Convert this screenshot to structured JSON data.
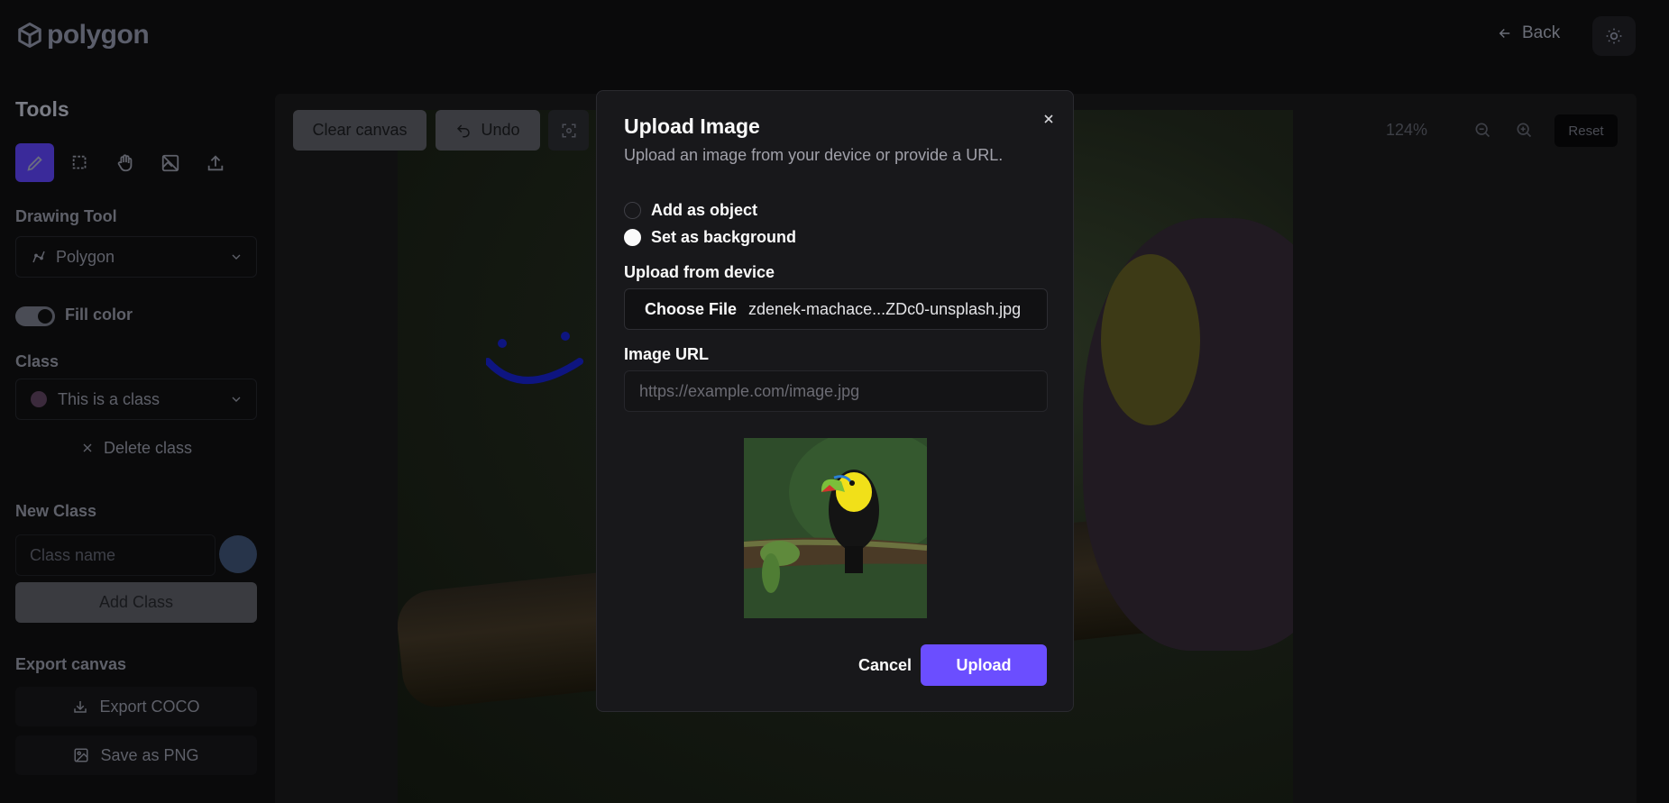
{
  "header": {
    "logo_text": "polygon",
    "back_label": "Back"
  },
  "sidebar": {
    "title": "Tools",
    "drawing_tool_label": "Drawing Tool",
    "drawing_tool_value": "Polygon",
    "fill_color_label": "Fill color",
    "class_label": "Class",
    "class_value": "This is a class",
    "delete_class_label": "Delete class",
    "new_class_label": "New Class",
    "class_name_placeholder": "Class name",
    "add_class_label": "Add Class",
    "export_label": "Export canvas",
    "export_coco_label": "Export COCO",
    "save_png_label": "Save as PNG"
  },
  "canvas": {
    "clear_label": "Clear canvas",
    "undo_label": "Undo",
    "zoom_level": "124%",
    "reset_label": "Reset"
  },
  "modal": {
    "title": "Upload Image",
    "description": "Upload an image from your device or provide a URL.",
    "options": [
      {
        "label": "Add as object",
        "checked": false
      },
      {
        "label": "Set as background",
        "checked": true
      }
    ],
    "upload_device_label": "Upload from device",
    "choose_file_label": "Choose File",
    "file_name": "zdenek-machace...ZDc0-unsplash.jpg",
    "image_url_label": "Image URL",
    "image_url_placeholder": "https://example.com/image.jpg",
    "cancel_label": "Cancel",
    "upload_label": "Upload"
  },
  "colors": {
    "accent": "#6b4eff",
    "modal_bg": "#18181b",
    "page_bg": "#0a0a0b"
  }
}
